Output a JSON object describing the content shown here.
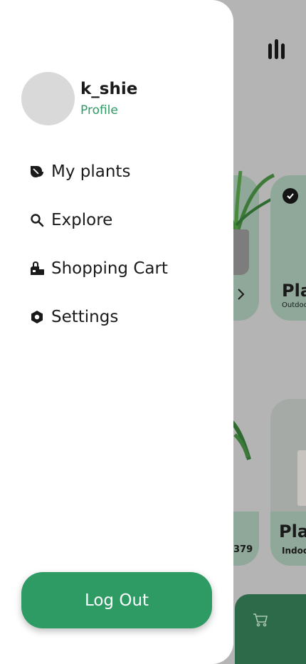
{
  "colors": {
    "accent": "#2e9a64",
    "drawer_bg": "#ffffff",
    "overlay_bg": "#b4b4b4",
    "bottom_bar": "#2d6a4a"
  },
  "drawer": {
    "username": "k_shie",
    "profile_link": "Profile",
    "menu": [
      {
        "label": "My plants",
        "icon": "plant-leaf-icon"
      },
      {
        "label": "Explore",
        "icon": "search-icon"
      },
      {
        "label": "Shopping Cart",
        "icon": "shopping-bags-icon"
      },
      {
        "label": "Settings",
        "icon": "settings-hexagon-icon"
      }
    ],
    "logout_label": "Log Out"
  },
  "background": {
    "menu_icon": "bar-chart-menu-icon",
    "cards": [
      {
        "title_partial": "Pla",
        "subtitle_partial": "Outdoo"
      },
      {
        "title_partial": "Pla",
        "subtitle_partial": "Indoo"
      }
    ],
    "price_partial": "379",
    "cart_icon": "cart-icon"
  }
}
